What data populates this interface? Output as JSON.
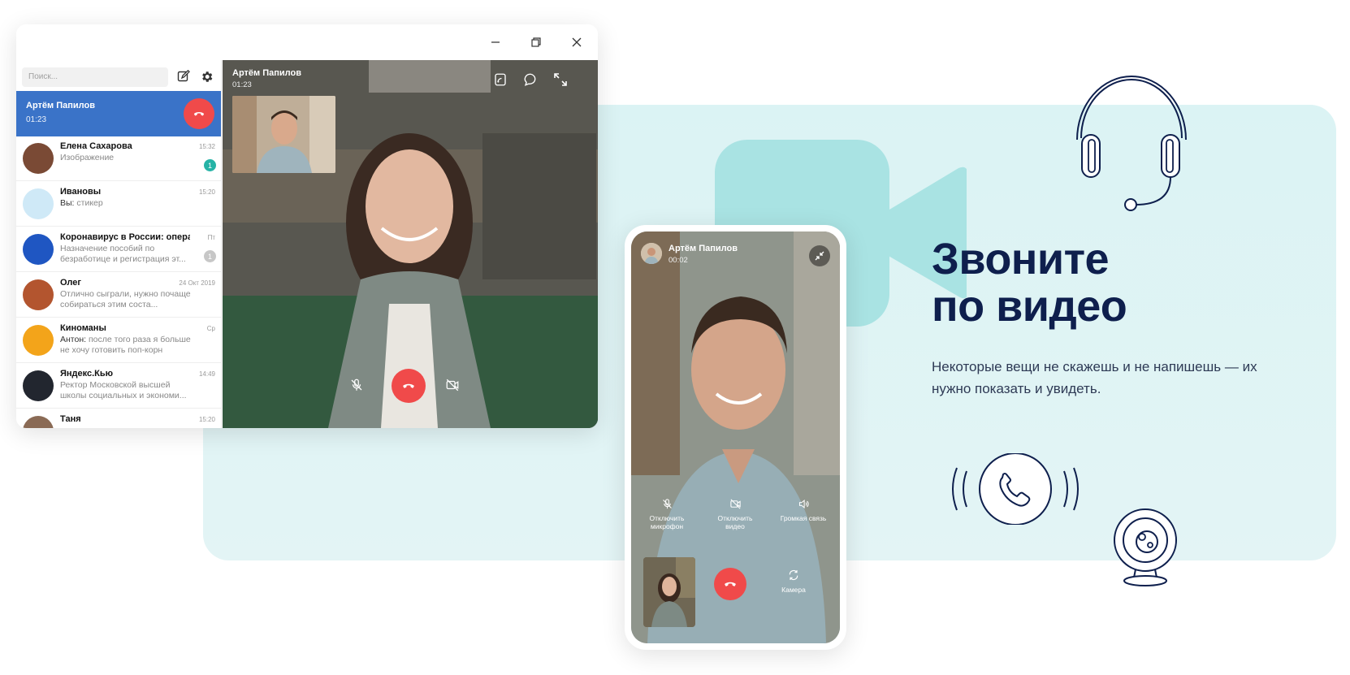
{
  "window": {
    "controls": {
      "minimize": "minimize-icon",
      "maximize": "maximize-icon",
      "close": "close-icon"
    }
  },
  "sidebar": {
    "search_placeholder": "Поиск...",
    "active_call": {
      "name": "Артём Папилов",
      "time": "01:23"
    },
    "chats": [
      {
        "name": "Елена Сахарова",
        "time": "15:32",
        "preview": "Изображение",
        "sender": "",
        "badge": "1",
        "badge_color": "#26b3a6",
        "avatar_color": "#7a4a35"
      },
      {
        "name": "Ивановы",
        "time": "15:20",
        "preview": "стикер",
        "sender": "Вы:",
        "badge": "",
        "avatar_color": "#cfe9f7"
      },
      {
        "name": "Коронавирус в России: операт...",
        "time": "Пт",
        "preview": "Назначение пособий по безработице и регистрация эт...",
        "sender": "",
        "badge": "1",
        "badge_color": "#c7c7c7",
        "avatar_color": "#1f56c2"
      },
      {
        "name": "Олег",
        "time": "24 Окт 2019",
        "preview": "Отлично сыграли, нужно почаще собираться этим соста...",
        "sender": "",
        "badge": "",
        "avatar_color": "#b3552f"
      },
      {
        "name": "Киноманы",
        "time": "Ср",
        "preview": "после того раза я больше не хочу готовить поп-корн",
        "sender": "Антон:",
        "badge": "",
        "avatar_color": "#f3a41a"
      },
      {
        "name": "Яндекс.Кью",
        "time": "14:49",
        "preview": "Ректор Московской высшей школы социальных и экономи...",
        "sender": "",
        "badge": "",
        "avatar_color": "#22262f"
      },
      {
        "name": "Таня",
        "time": "15:20",
        "preview": "",
        "sender": "",
        "badge": "",
        "avatar_color": "#8a6a55"
      }
    ]
  },
  "video_call": {
    "name": "Артём Папилов",
    "time": "01:23"
  },
  "phone": {
    "name": "Артём Папилов",
    "time": "00:02",
    "controls": {
      "mic": "Отключить микрофон",
      "video": "Отключить видео",
      "speaker": "Громкая связь",
      "camera": "Камера"
    }
  },
  "promo": {
    "headline_line1": "Звоните",
    "headline_line2": "по видео",
    "subtitle": "Некоторые вещи не скажешь и не напишешь — их нужно показать и увидеть."
  },
  "colors": {
    "accent_blue": "#3a73c8",
    "hangup_red": "#f04a4a",
    "panel_teal": "#dbf3f4",
    "headline_navy": "#0e1f4d"
  }
}
